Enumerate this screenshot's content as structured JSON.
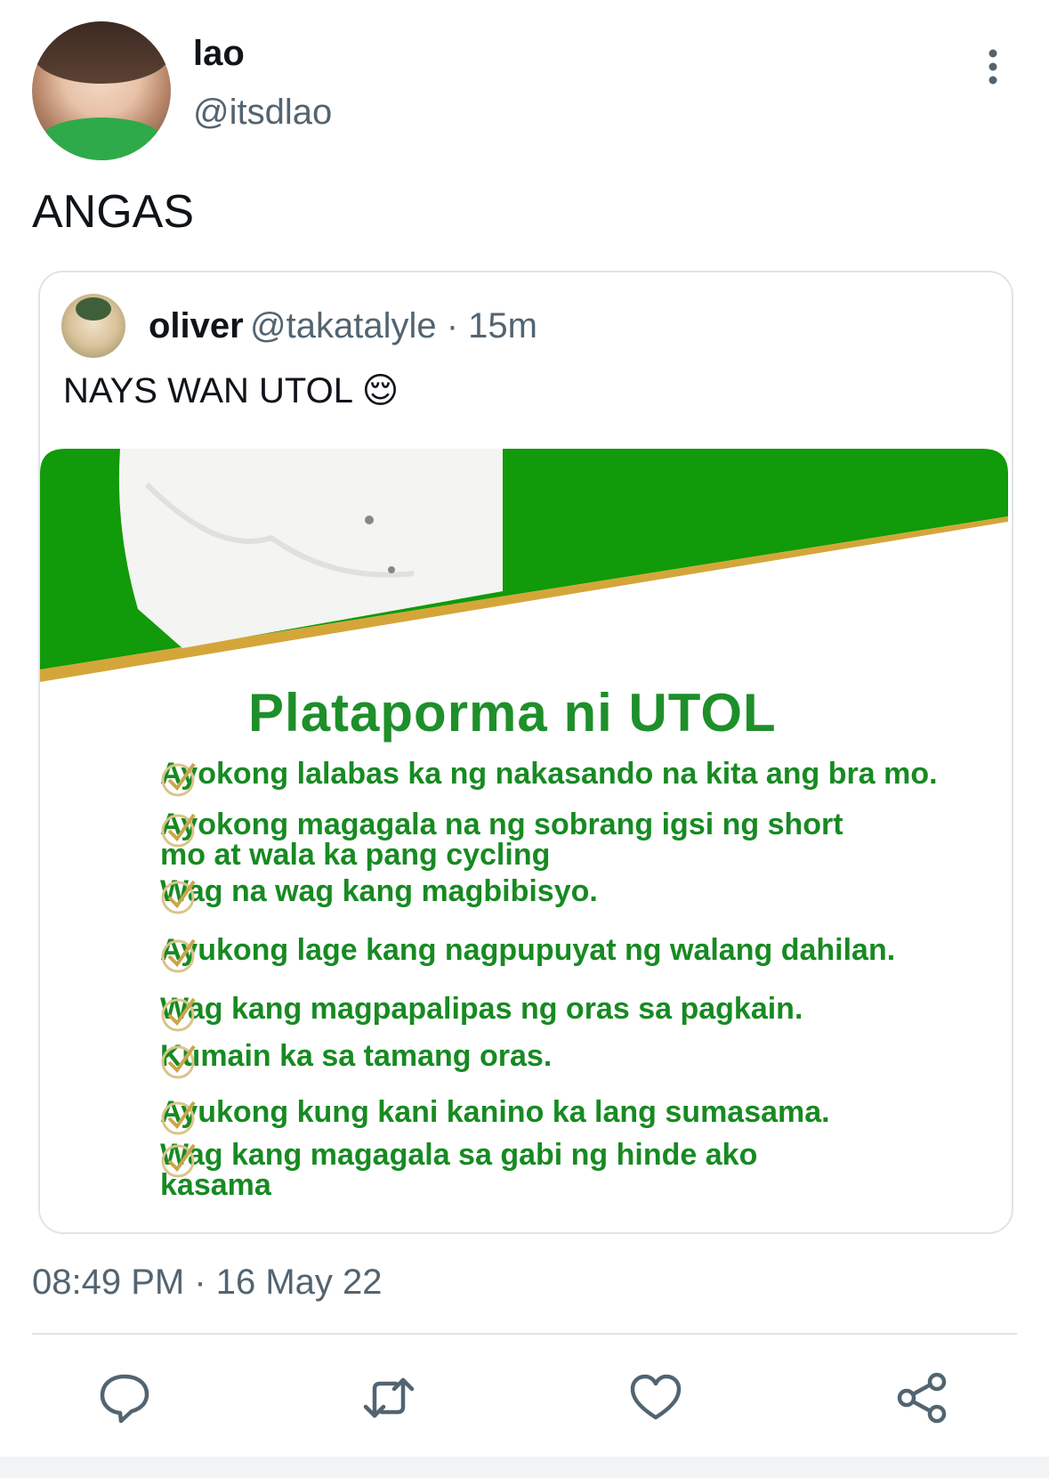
{
  "author": {
    "display_name": "lao",
    "handle": "@itsdlao"
  },
  "tweet": {
    "text": "ANGAS",
    "timestamp": "08:49 PM · 16 May 22"
  },
  "quoted": {
    "display_name": "oliver",
    "meta": "@takatalyle · 15m",
    "text": "NAYS WAN UTOL 😌",
    "image": {
      "title": "Plataporma ni UTOL",
      "items": [
        "Ayokong lalabas ka ng nakasando na kita ang bra mo.",
        "Ayokong magagala na ng sobrang igsi ng short mo at wala ka pang cycling",
        "Wag na wag kang magbibisyo.",
        "Ayukong lage kang nagpupuyat ng walang dahilan.",
        "Wag kang magpapalipas ng oras sa pagkain.",
        "Kumain ka sa tamang oras.",
        "Ayukong kung kani kanino ka lang sumasama.",
        "Wag kang magagala sa gabi ng hinde ako kasama"
      ]
    }
  },
  "icons": {
    "more": "more-vertical-icon",
    "reply": "reply-icon",
    "retweet": "retweet-icon",
    "like": "heart-icon",
    "share": "share-icon"
  },
  "colors": {
    "green": "#119a09",
    "gold": "#d4a63a",
    "gray_text": "#536471",
    "check_green": "#178a22"
  }
}
